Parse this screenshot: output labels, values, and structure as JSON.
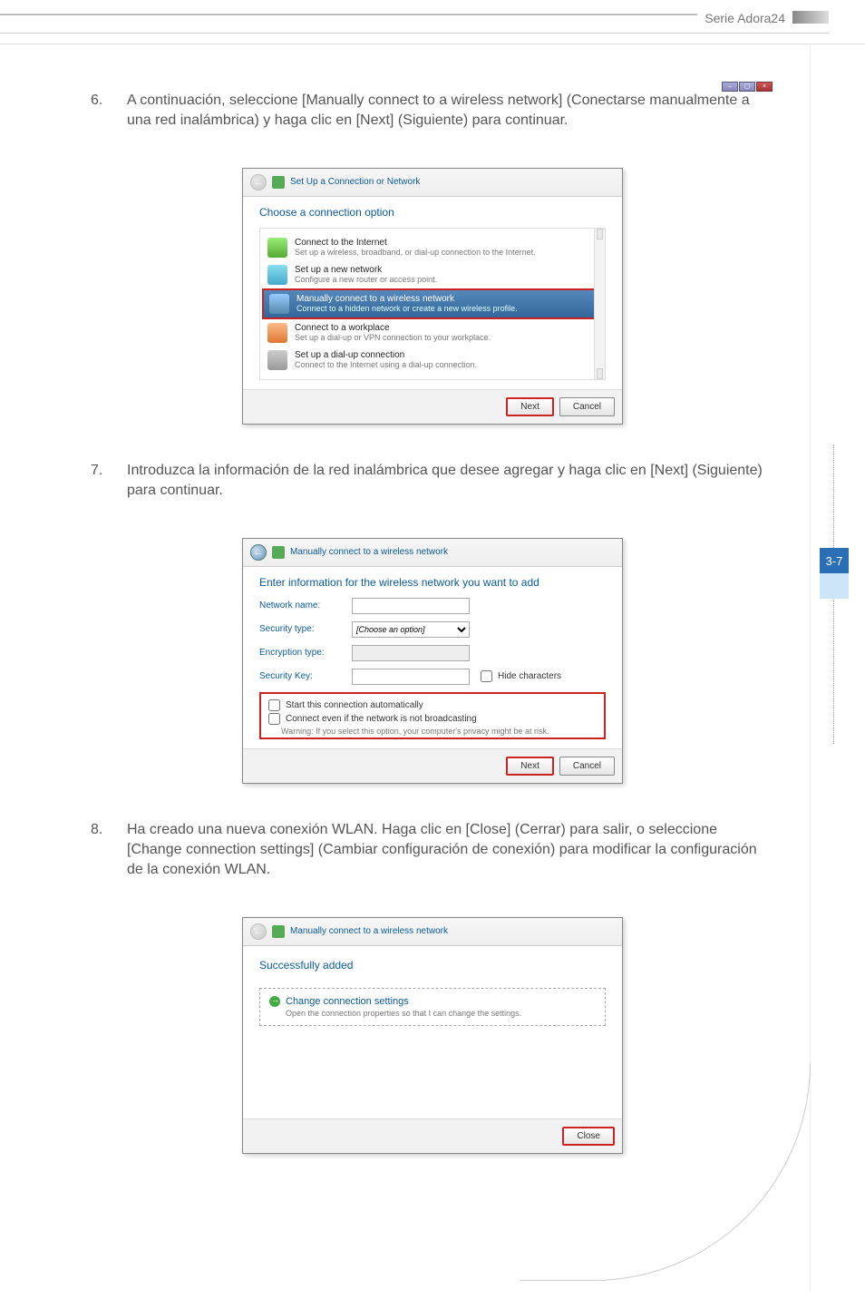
{
  "header": {
    "series": "Serie Adora24"
  },
  "sideTab": "3-7",
  "steps": {
    "s6": {
      "num": "6.",
      "text": "A continuación, seleccione [Manually connect to a wireless network] (Conectarse manualmente a una red inalámbrica) y haga clic en [Next] (Siguiente) para continuar."
    },
    "s7": {
      "num": "7.",
      "text": "Introduzca la información de la red inalámbrica que desee agregar y haga clic en [Next] (Siguiente) para continuar."
    },
    "s8": {
      "num": "8.",
      "text": "Ha creado una nueva conexión WLAN. Haga clic en [Close] (Cerrar) para salir, o seleccione [Change connection settings] (Cambiar configuración de conexión) para modificar la configuración de la conexión WLAN."
    }
  },
  "dialog1": {
    "title": "Set Up a Connection or Network",
    "heading": "Choose a connection option",
    "options": [
      {
        "title": "Connect to the Internet",
        "sub": "Set up a wireless, broadband, or dial-up connection to the Internet."
      },
      {
        "title": "Set up a new network",
        "sub": "Configure a new router or access point."
      },
      {
        "title": "Manually connect to a wireless network",
        "sub": "Connect to a hidden network or create a new wireless profile."
      },
      {
        "title": "Connect to a workplace",
        "sub": "Set up a dial-up or VPN connection to your workplace."
      },
      {
        "title": "Set up a dial-up connection",
        "sub": "Connect to the Internet using a dial-up connection."
      }
    ],
    "next": "Next",
    "cancel": "Cancel"
  },
  "dialog2": {
    "title": "Manually connect to a wireless network",
    "heading": "Enter information for the wireless network you want to add",
    "labels": {
      "name": "Network name:",
      "secType": "Security type:",
      "encType": "Encryption type:",
      "secKey": "Security Key:"
    },
    "placeholders": {
      "choose": "[Choose an option]"
    },
    "hideChars": "Hide characters",
    "chkAuto": "Start this connection automatically",
    "chkBroadcast": "Connect even if the network is not broadcasting",
    "warning": "Warning: If you select this option, your computer's privacy might be at risk.",
    "next": "Next",
    "cancel": "Cancel"
  },
  "dialog3": {
    "title": "Manually connect to a wireless network",
    "heading": "Successfully added",
    "changeLink": "Change connection settings",
    "changeSub": "Open the connection properties so that I can change the settings.",
    "close": "Close"
  }
}
